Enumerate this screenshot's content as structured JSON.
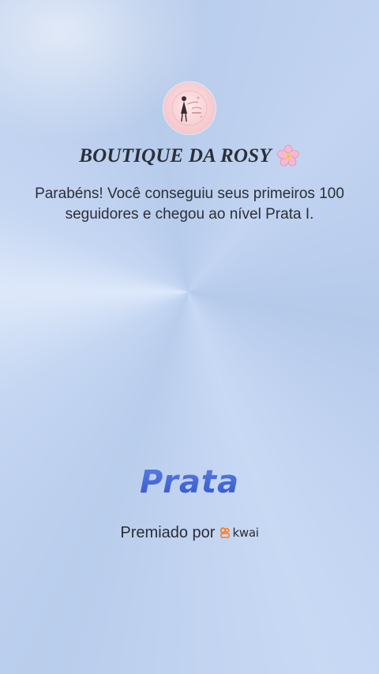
{
  "shop": {
    "name": "BOUTIQUE DA ROSY",
    "emoji_icon": "cherry-blossom-icon"
  },
  "message": "Parabéns! Você conseguiu seus primeiros 100 seguidores e chegou ao nível Prata I.",
  "level": {
    "name": "Prata"
  },
  "awarded": {
    "label": "Premiado por",
    "brand": "kwai"
  },
  "colors": {
    "level_blue": "#3f62d6",
    "kwai_orange": "#ff7a1a",
    "background": "#bccfee"
  }
}
